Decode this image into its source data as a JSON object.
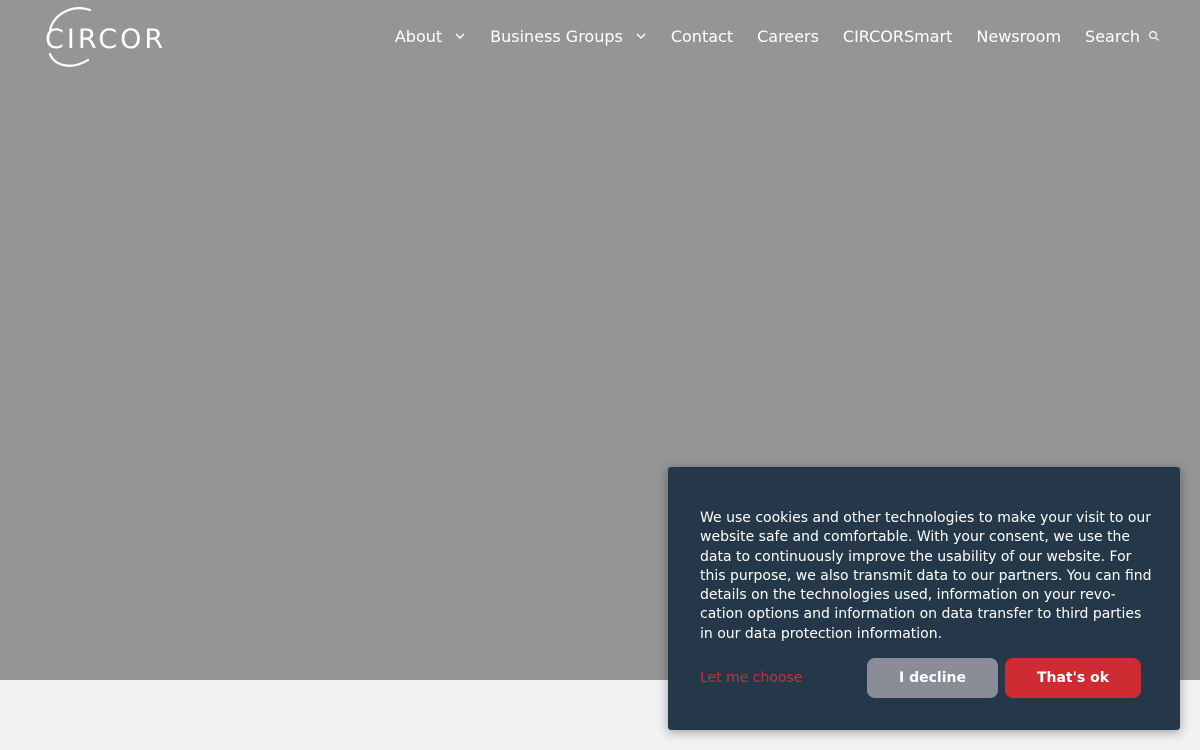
{
  "header": {
    "logo_text": "CIRCOR",
    "nav": [
      {
        "label": "About",
        "has_dropdown": true
      },
      {
        "label": "Business Groups",
        "has_dropdown": true
      },
      {
        "label": "Contact",
        "has_dropdown": false
      },
      {
        "label": "Careers",
        "has_dropdown": false
      },
      {
        "label": "CIRCORSmart",
        "has_dropdown": false
      },
      {
        "label": "Newsroom",
        "has_dropdown": false
      }
    ],
    "search_label": "Search",
    "icons": {
      "dropdown": "chevron-down-icon",
      "search": "search-icon"
    }
  },
  "cookie_banner": {
    "text": "We use cookies and other technologies to make your visit to our website safe and comfortable. With your consent, we use the data to continuously improve the usability of our website. For this purpose, we also transmit data to our partners. You can find details on the technologies used, information on your revo­cation options and information on data transfer to third parties in our data protection information.",
    "choose_label": "Let me choose",
    "decline_label": "I decline",
    "accept_label": "That's ok"
  },
  "colors": {
    "hero_background": "#959595",
    "banner_background": "#25384a",
    "accent_red": "#cf2b33",
    "decline_gray": "#8a8d97",
    "page_background": "#f1f1f3"
  }
}
